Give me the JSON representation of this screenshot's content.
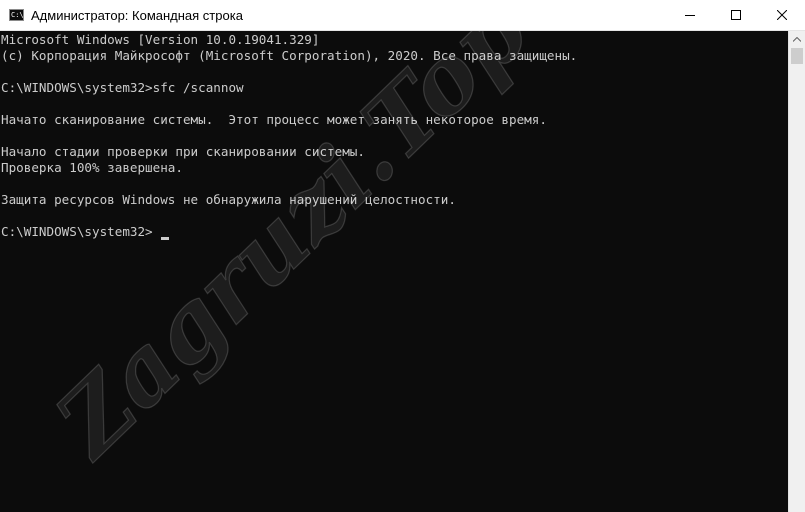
{
  "window": {
    "title": "Администратор: Командная строка",
    "app_icon_text": "C:\\"
  },
  "console": {
    "lines": [
      "Microsoft Windows [Version 10.0.19041.329]",
      "(c) Корпорация Майкрософт (Microsoft Corporation), 2020. Все права защищены.",
      "",
      "C:\\WINDOWS\\system32>sfc /scannow",
      "",
      "Начато сканирование системы.  Этот процесс может занять некоторое время.",
      "",
      "Начало стадии проверки при сканировании системы.",
      "Проверка 100% завершена.",
      "",
      "Защита ресурсов Windows не обнаружила нарушений целостности.",
      "",
      "C:\\WINDOWS\\system32>"
    ]
  },
  "watermark": {
    "text": "Zagruzi.Top"
  },
  "colors": {
    "console_bg": "#0c0c0c",
    "console_fg": "#cccccc",
    "titlebar_bg": "#ffffff"
  }
}
